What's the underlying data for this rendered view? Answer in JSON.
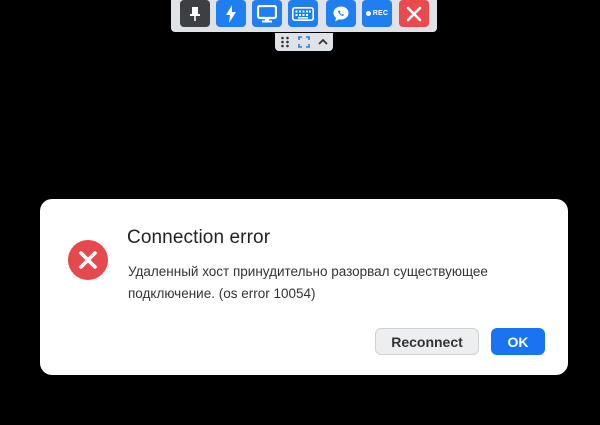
{
  "toolbar": {
    "buttons": [
      {
        "icon": "pin-icon",
        "color": "#3d3f43"
      },
      {
        "icon": "lightning-icon",
        "color": "#1f7ff0"
      },
      {
        "icon": "monitor-icon",
        "color": "#1f7ff0"
      },
      {
        "icon": "keyboard-icon",
        "color": "#1f7ff0"
      },
      {
        "icon": "chat-icon",
        "color": "#1f7ff0"
      },
      {
        "icon": "record-icon",
        "color": "#1f7ff0",
        "label": "REC"
      },
      {
        "icon": "close-icon",
        "color": "#e84a4d"
      }
    ]
  },
  "subbar": {
    "icons": [
      "drag-handle-icon",
      "fullscreen-icon",
      "chevron-up-icon"
    ]
  },
  "dialog": {
    "title": "Connection error",
    "message": "Удаленный хост принудительно разорвал существующее подключение. (os error 10054)",
    "icon": "error-icon",
    "reconnect_label": "Reconnect",
    "ok_label": "OK",
    "accent_color": "#1a73f0",
    "error_color": "#e5484d"
  }
}
